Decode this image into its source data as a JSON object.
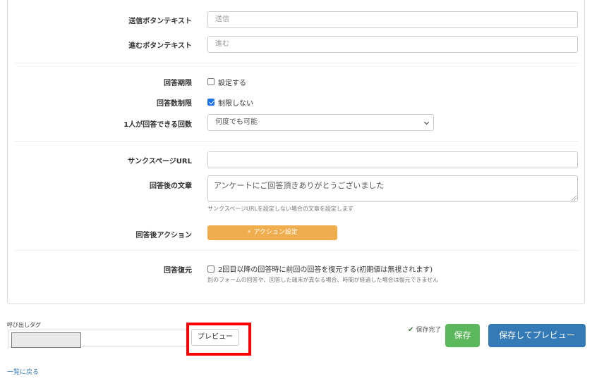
{
  "form": {
    "submit_text": {
      "label": "送信ボタンテキスト",
      "placeholder": "送信"
    },
    "next_text": {
      "label": "進むボタンテキスト",
      "placeholder": "進む"
    },
    "deadline": {
      "label": "回答期限",
      "checkbox_label": "設定する",
      "checked": false
    },
    "limit": {
      "label": "回答数制限",
      "checkbox_label": "制限しない",
      "checked": true
    },
    "per_person": {
      "label": "1人が回答できる回数",
      "selected": "何度でも可能"
    },
    "thanks_url": {
      "label": "サンクスページURL",
      "value": ""
    },
    "after_text": {
      "label": "回答後の文章",
      "value": "アンケートにご回答頂きありがとうございました",
      "help": "サンクスページURLを設定しない場合の文章を設定します"
    },
    "after_action": {
      "label": "回答後アクション",
      "button_label": "アクション設定",
      "button_icon": "bolt-icon"
    },
    "restore": {
      "label": "回答復元",
      "checkbox_label": "2回目以降の回答時に前回の回答を復元する(初期値は無視されます)",
      "checked": false,
      "help": "別のフォームの回答や、回答した端末が異なる場合、時間が経過した場合は復元できません"
    }
  },
  "footer": {
    "call_tag_label": "呼び出しタグ",
    "preview_label": "プレビュー",
    "saved_status": "保存完了",
    "save_label": "保存",
    "save_preview_label": "保存してプレビュー",
    "back_link": "一覧に戻る"
  },
  "colors": {
    "action_button": "#f0ad4e",
    "save_button": "#5cb85c",
    "save_preview_button": "#337ab7",
    "highlight_box": "#ff0000",
    "link": "#337ab7"
  }
}
